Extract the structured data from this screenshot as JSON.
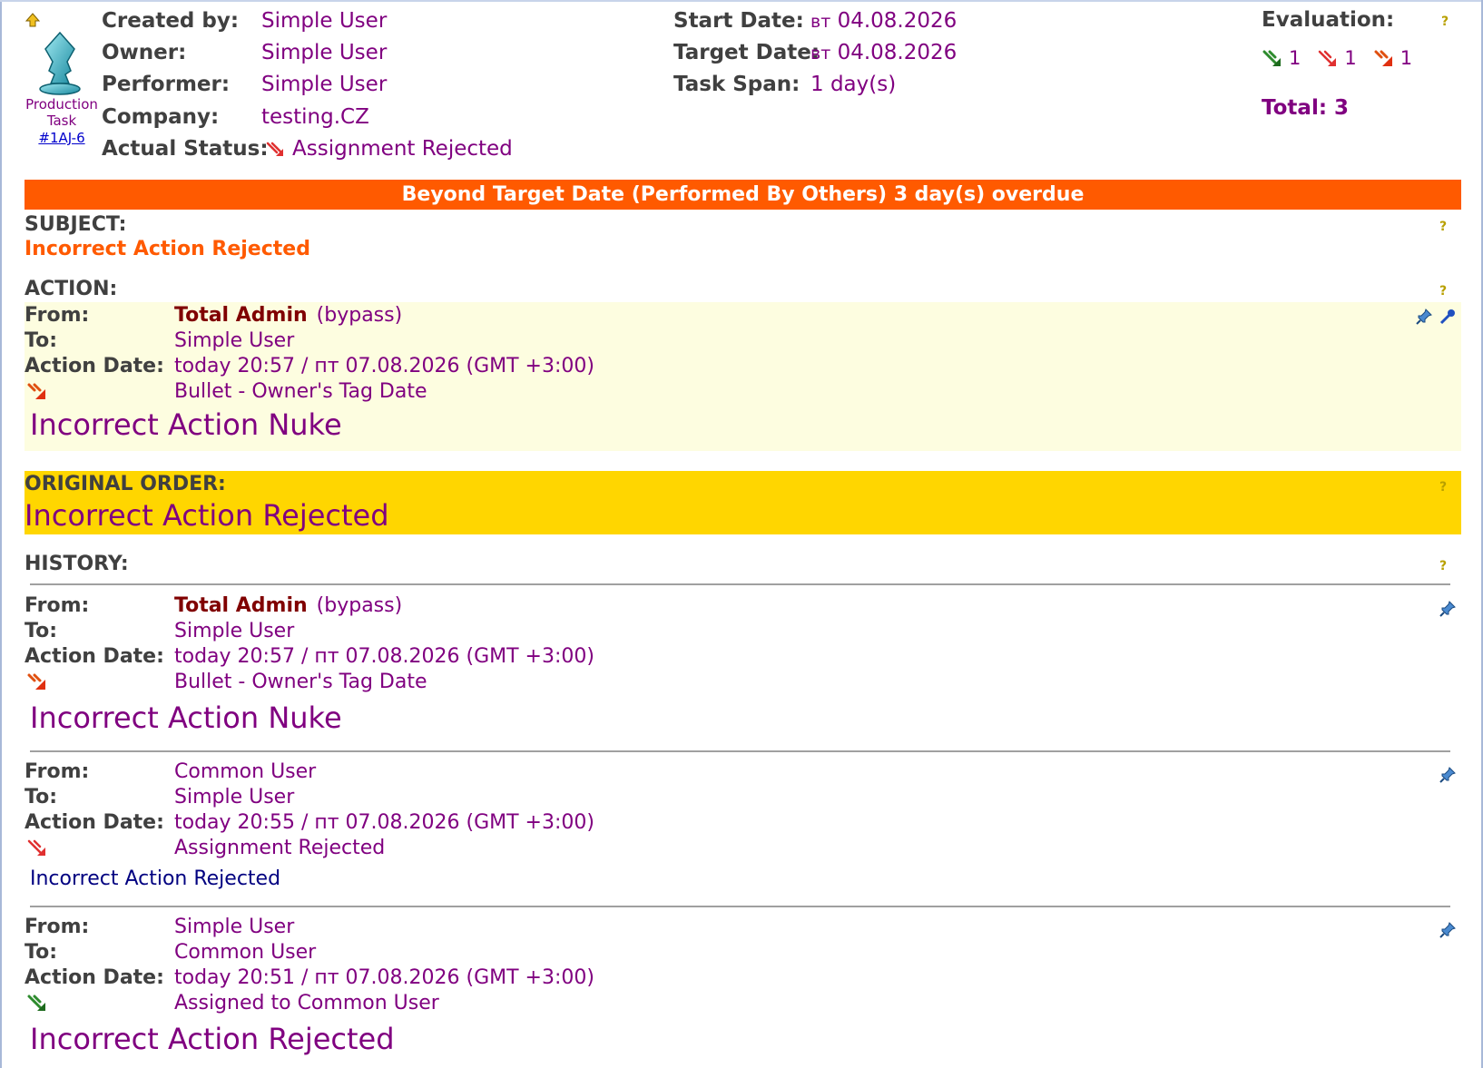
{
  "task": {
    "type_label": "Production Task",
    "id_link": "#1AJ-6"
  },
  "header": {
    "created_by_label": "Created by:",
    "created_by": "Simple User",
    "owner_label": "Owner:",
    "owner": "Simple User",
    "performer_label": "Performer:",
    "performer": "Simple User",
    "company_label": "Company:",
    "company": "testing.CZ",
    "actual_status_label": "Actual Status:",
    "actual_status": "Assignment Rejected",
    "start_date_label": "Start Date:",
    "start_date_day": "вт",
    "start_date": "04.08.2026",
    "target_date_label": "Target Date:",
    "target_date_day": "вт",
    "target_date": "04.08.2026",
    "task_span_label": "Task Span:",
    "task_span": "1 day(s)",
    "evaluation_label": "Evaluation:",
    "evaluation": [
      {
        "icon": "green-arrow-icon",
        "count": "1",
        "color": "#2e8b2e"
      },
      {
        "icon": "red-striped-arrow-icon",
        "count": "1",
        "color": "#e03030"
      },
      {
        "icon": "orange-arrow-icon",
        "count": "1",
        "color": "#e05010"
      }
    ],
    "total": "Total: 3"
  },
  "overdue_banner": "Beyond Target Date (Performed By Others) 3 day(s) overdue",
  "subject": {
    "label": "SUBJECT:",
    "text": "Incorrect Action Rejected"
  },
  "action": {
    "label": "ACTION:",
    "from_label": "From:",
    "from": "Total Admin",
    "from_note": "(bypass)",
    "to_label": "To:",
    "to": "Simple User",
    "date_label": "Action Date:",
    "date": "today 20:57 / пт 07.08.2026 (GMT +3:00)",
    "kind": "Bullet - Owner's Tag Date",
    "message": "Incorrect Action Nuke"
  },
  "original_order": {
    "label": "ORIGINAL ORDER:",
    "text": "Incorrect Action Rejected"
  },
  "history": {
    "label": "HISTORY:",
    "entries": [
      {
        "from_label": "From:",
        "from": "Total Admin",
        "from_note": "(bypass)",
        "to_label": "To:",
        "to": "Simple User",
        "date_label": "Action Date:",
        "date": "today 20:57 / пт 07.08.2026 (GMT +3:00)",
        "kind": "Bullet - Owner's Tag Date",
        "message": "Incorrect Action Nuke"
      },
      {
        "from_label": "From:",
        "from": "Common User",
        "from_note": "",
        "to_label": "To:",
        "to": "Simple User",
        "date_label": "Action Date:",
        "date": "today 20:55 / пт 07.08.2026 (GMT +3:00)",
        "kind": "Assignment Rejected",
        "message": "Incorrect Action Rejected"
      },
      {
        "from_label": "From:",
        "from": "Simple User",
        "from_note": "",
        "to_label": "To:",
        "to": "Common User",
        "date_label": "Action Date:",
        "date": "today 20:51 / пт 07.08.2026 (GMT +3:00)",
        "kind": "Assigned to Common User",
        "message": "Incorrect Action Rejected"
      }
    ]
  },
  "help_glyph": "?"
}
